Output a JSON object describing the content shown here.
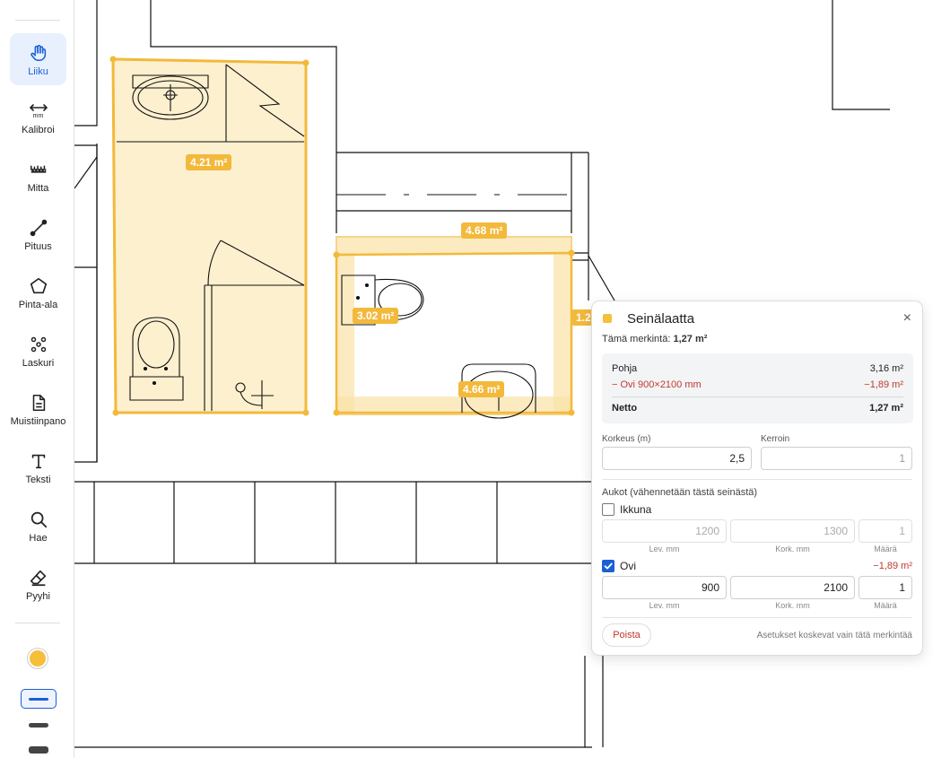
{
  "toolbar": {
    "tools": [
      {
        "id": "move",
        "label": "Liiku",
        "icon": "hand-icon",
        "active": true
      },
      {
        "id": "calibrate",
        "label": "Kalibroi",
        "icon": "calibrate-icon",
        "active": false
      },
      {
        "id": "measure",
        "label": "Mitta",
        "icon": "ruler-icon",
        "active": false
      },
      {
        "id": "length",
        "label": "Pituus",
        "icon": "line-icon",
        "active": false
      },
      {
        "id": "area",
        "label": "Pinta-ala",
        "icon": "polygon-icon",
        "active": false
      },
      {
        "id": "counter",
        "label": "Laskuri",
        "icon": "dots-icon",
        "active": false
      },
      {
        "id": "note",
        "label": "Muistiinpano",
        "icon": "note-icon",
        "active": false
      },
      {
        "id": "text",
        "label": "Teksti",
        "icon": "text-icon",
        "active": false
      },
      {
        "id": "search",
        "label": "Hae",
        "icon": "search-icon",
        "active": false
      },
      {
        "id": "erase",
        "label": "Pyyhi",
        "icon": "eraser-icon",
        "active": false
      }
    ],
    "calibrate_unit": "mm",
    "color": "#f5bf3a"
  },
  "canvas": {
    "labels": {
      "room1": "4.21 m²",
      "room2_top": "4.68 m²",
      "room2_left": "3.02 m²",
      "room2_bottom": "4.66 m²",
      "room2_right": "1.2"
    },
    "accent": "#f2b93b"
  },
  "panel": {
    "title": "Seinälaatta",
    "close": "×",
    "summary_label": "Tämä merkintä:",
    "summary_value": "1,27 m²",
    "base_label": "Pohja",
    "base_value": "3,16 m²",
    "door_label": "− Ovi 900×2100 mm",
    "door_value": "−1,89 m²",
    "net_label": "Netto",
    "net_value": "1,27 m²",
    "height_label": "Korkeus (m)",
    "height_value": "2,5",
    "factor_label": "Kerroin",
    "factor_value": "1",
    "openings_title": "Aukot (vähennetään tästä seinästä)",
    "window_label": "Ikkuna",
    "window_checked": false,
    "window_width": "1200",
    "window_height": "1300",
    "window_count": "1",
    "door_cb_label": "Ovi",
    "door_checked": true,
    "door_deduct": "−1,89 m²",
    "door_width": "900",
    "door_height": "2100",
    "door_count": "1",
    "col_width": "Lev. mm",
    "col_height": "Kork. mm",
    "col_count": "Määrä",
    "delete_label": "Poista",
    "note": "Asetukset koskevat vain tätä merkintää"
  }
}
